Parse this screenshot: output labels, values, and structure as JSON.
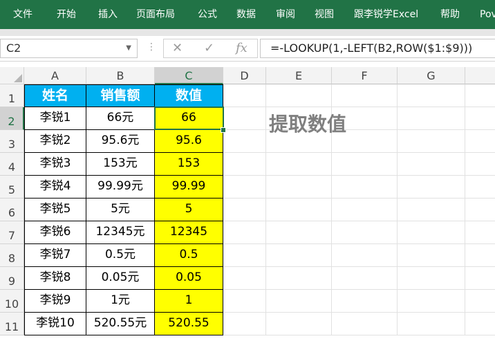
{
  "ribbon": {
    "tabs": [
      "文件",
      "开始",
      "插入",
      "页面布局",
      "公式",
      "数据",
      "审阅",
      "视图",
      "跟李锐学Excel",
      "帮助",
      "Pov"
    ]
  },
  "formula_bar": {
    "name_box": "C2",
    "cancel_glyph": "✕",
    "enter_glyph": "✓",
    "fx_label": "fx",
    "formula": "=-LOOKUP(1,-LEFT(B2,ROW($1:$9)))"
  },
  "columns": [
    "A",
    "B",
    "C",
    "D",
    "E",
    "F",
    "G"
  ],
  "rows": [
    "1",
    "2",
    "3",
    "4",
    "5",
    "6",
    "7",
    "8",
    "9",
    "10",
    "11"
  ],
  "table": {
    "headers": [
      "姓名",
      "销售额",
      "数值"
    ],
    "rows": [
      [
        "李锐1",
        "66元",
        "66"
      ],
      [
        "李锐2",
        "95.6元",
        "95.6"
      ],
      [
        "李锐3",
        "153元",
        "153"
      ],
      [
        "李锐4",
        "99.99元",
        "99.99"
      ],
      [
        "李锐5",
        "5元",
        "5"
      ],
      [
        "李锐6",
        "12345元",
        "12345"
      ],
      [
        "李锐7",
        "0.5元",
        "0.5"
      ],
      [
        "李锐8",
        "0.05元",
        "0.05"
      ],
      [
        "李锐9",
        "1元",
        "1"
      ],
      [
        "李锐10",
        "520.55元",
        "520.55"
      ]
    ]
  },
  "annotation": "提取数值",
  "colors": {
    "ribbon": "#217346",
    "header_fill": "#00b0f0",
    "value_fill": "#ffff00",
    "title_text": "#7f7f7f"
  }
}
